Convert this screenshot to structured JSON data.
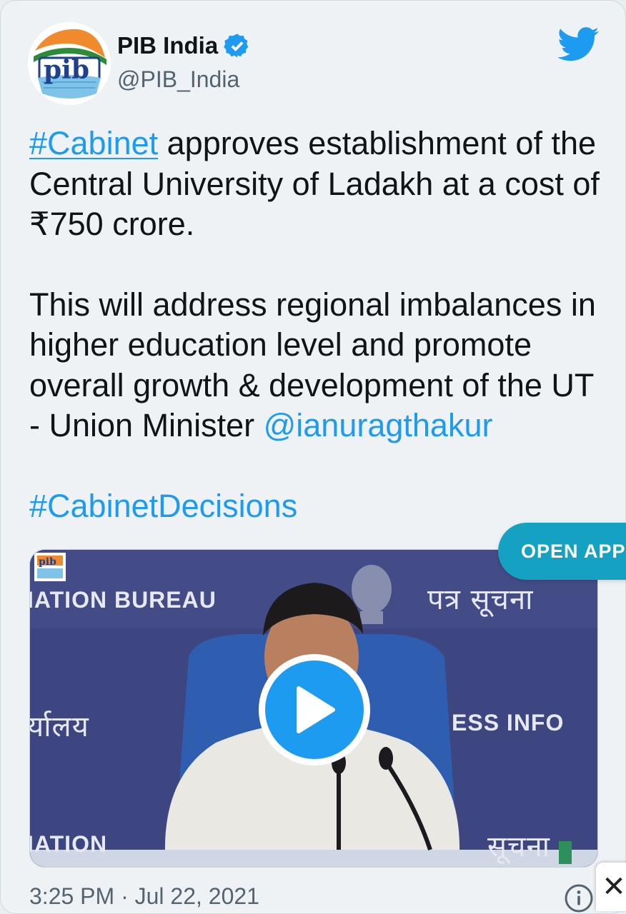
{
  "account": {
    "display_name": "PIB India",
    "handle": "@PIB_India",
    "logo_text": "pib"
  },
  "tweet": {
    "hashtag_cabinet": "#Cabinet",
    "line1_rest": " approves establishment of the Central University of Ladakh at a cost of ₹750 crore.",
    "para2": "This will address regional imbalances in higher education level and promote overall growth & development of the UT - Union Minister ",
    "mention": "@ianuragthakur",
    "hashtag_decisions": "#CabinetDecisions"
  },
  "media": {
    "wall_text_top_left": "IATION BUREAU",
    "wall_text_top_right": "पत्र सूचना",
    "wall_text_mid_left": "र्यालय",
    "wall_text_mid_right": "ESS INFO",
    "wall_text_bottom_left": "IATION",
    "wall_text_bottom_right": "सूचना"
  },
  "open_app_label": "OPEN APP",
  "timestamp": "3:25 PM · Jul 22, 2021",
  "close_label": "✕",
  "colors": {
    "link": "#1d9bf0",
    "open_app_bg": "#15a1c2",
    "play_button": "#1d9bf0",
    "card_bg": "#eef2f5"
  },
  "icons": [
    "verified-badge-icon",
    "twitter-bird-icon",
    "play-icon",
    "info-icon",
    "close-icon"
  ]
}
